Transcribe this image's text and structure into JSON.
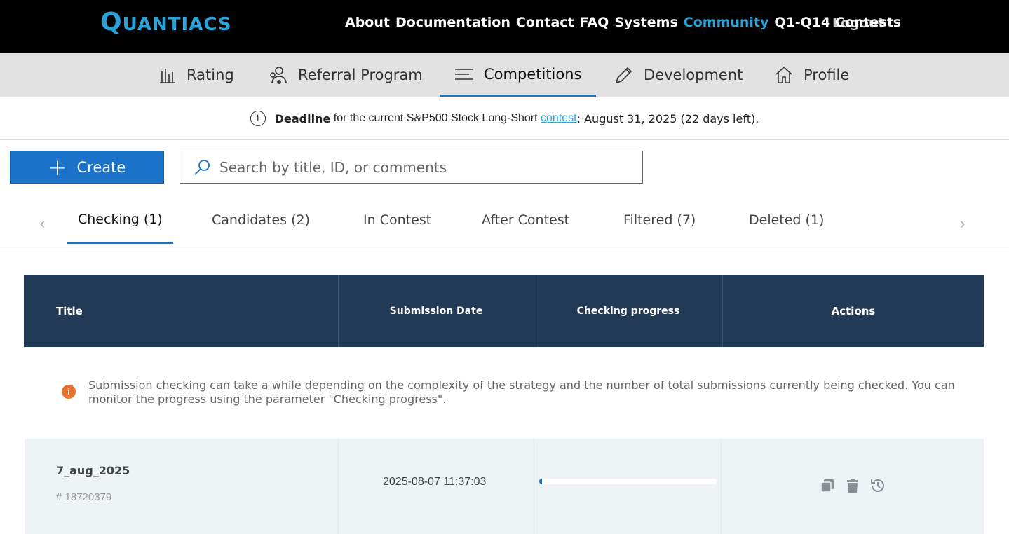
{
  "brand": {
    "logo_first": "Q",
    "logo_rest": "UANTIACS"
  },
  "topnav": {
    "items": [
      "About",
      "Documentation",
      "Contact",
      "FAQ",
      "Systems",
      "Community",
      "Q1-Q14 Contests"
    ],
    "active": "Community",
    "logout": "Logout"
  },
  "subnav": {
    "items": [
      {
        "label": "Rating",
        "icon": "bar-chart-icon"
      },
      {
        "label": "Referral Program",
        "icon": "users-plus-icon"
      },
      {
        "label": "Competitions",
        "icon": "lines-icon"
      },
      {
        "label": "Development",
        "icon": "pencil-icon"
      },
      {
        "label": "Profile",
        "icon": "home-icon"
      }
    ],
    "active": "Competitions"
  },
  "deadline": {
    "bold": "Deadline",
    "text": "for the current S&P500 Stock Long-Short",
    "link": "contest",
    "date": ": August 31, 2025 (22 days left)."
  },
  "create_label": "Create",
  "search": {
    "placeholder": "Search by title, ID, or comments"
  },
  "tabs": [
    "Checking (1)",
    "Candidates (2)",
    "In Contest",
    "After Contest",
    "Filtered (7)",
    "Deleted (1)"
  ],
  "active_tab": "Checking (1)",
  "table": {
    "headers": [
      "Title",
      "Submission Date",
      "Checking progress",
      "Actions"
    ],
    "notice": "Submission checking can take a while depending on the complexity of the strategy and the number of total submissions currently being checked. You can monitor the progress using the parameter \"Checking progress\".",
    "rows": [
      {
        "title": "7_aug_2025",
        "id": "# 18720379",
        "date": "2025-08-07 11:37:03",
        "progress": 0.01
      }
    ]
  },
  "colors": {
    "accent": "#1a73c8",
    "brand": "#2aa3d9",
    "header_bg": "#223a55",
    "notice_icon": "#e8702a"
  }
}
